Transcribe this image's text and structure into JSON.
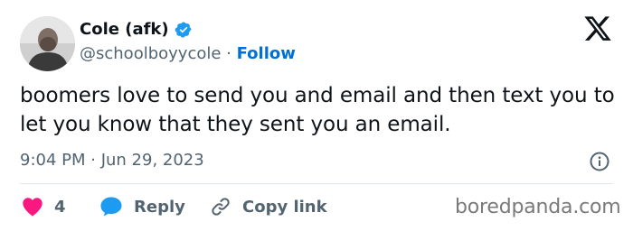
{
  "author": {
    "name": "Cole (afk)",
    "handle": "@schoolboyycole",
    "separator": " · ",
    "follow_label": "Follow",
    "verified_icon": "verified-badge-icon",
    "avatar_icon": "profile-photo"
  },
  "platform_logo": "x-logo-icon",
  "tweet": {
    "text": "boomers love to send you and email and then text you to let you know that they sent you an email.",
    "timestamp": "9:04 PM · Jun 29, 2023"
  },
  "actions": {
    "like_count": "4",
    "reply_label": "Reply",
    "copy_link_label": "Copy link"
  },
  "watermark": "boredpanda.com",
  "colors": {
    "accent": "#1d9bf0",
    "follow": "#006fd6",
    "like": "#f91880",
    "muted": "#536471"
  }
}
